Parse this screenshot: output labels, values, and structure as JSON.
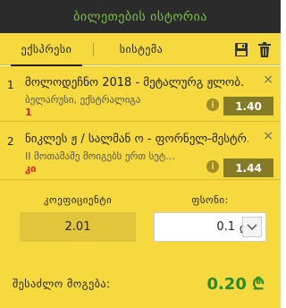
{
  "header": {
    "title": "ბილეთების ისტორია"
  },
  "tabs": {
    "express": "ექსპრესი",
    "system": "სისტემა"
  },
  "bets": [
    {
      "index": "1",
      "title": "მოლოდეჩნო 2018 - მეტალურგ ჟლობ.",
      "subtitle": "ბელარუსი, ექსტრალიგა",
      "outcome": "1",
      "odd": "1.40",
      "info": "i",
      "close": "×"
    },
    {
      "index": "2",
      "title": "ნიკლეს ჟ / სალმან ო - ფორნელ-მესტრ…",
      "subtitle": "II მოთამაშე მოიგებს ერთ სეტ…",
      "outcome": "კი",
      "odd": "1.44",
      "info": "i",
      "close": "×"
    }
  ],
  "summary": {
    "coef_label": "კოეფიციენტი",
    "coef_value": "2.01",
    "stake_label": "ფსონი:",
    "stake_value": "0.1",
    "stake_currency": "₾",
    "win_label": "შესაძლო მოგება:",
    "win_value": "0.20 ₾"
  },
  "colors": {
    "panel": "#f5d93f",
    "header": "#2b2b2b",
    "header_text": "#7bc24a",
    "odd_badge": "#857a25",
    "win": "#2a8a2a",
    "outcome": "#d3231e"
  },
  "icons": {
    "save": "save-icon",
    "trash": "trash-icon",
    "info": "info-icon",
    "close": "close-icon",
    "dropdown": "chevron-down-icon"
  }
}
